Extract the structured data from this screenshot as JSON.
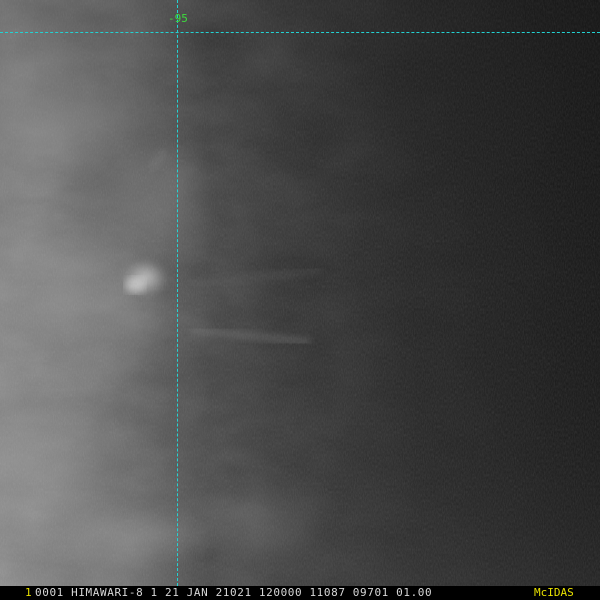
{
  "image": {
    "gridline_color": "#22d3d3",
    "grid_label_color": "#3ddc3d",
    "grid_label": "-95"
  },
  "status_bar": {
    "frame_number": "1",
    "info": "0001 HIMAWARI-8   1 21 JAN 21021 120000 11087 09701 01.00",
    "brand": "McIDAS",
    "frame_number_color": "#e8e000",
    "brand_color": "#e8e000"
  }
}
